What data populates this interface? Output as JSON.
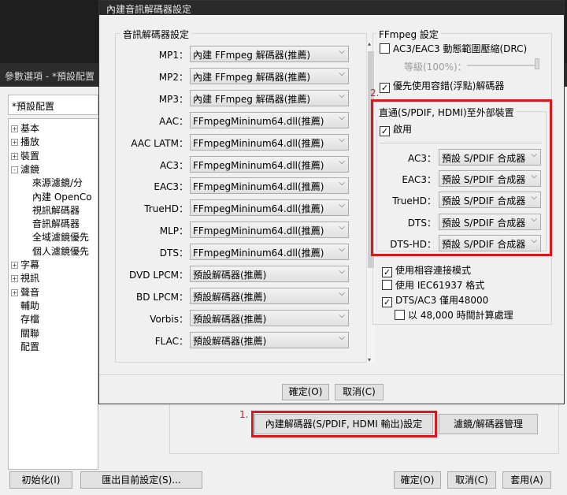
{
  "bg_window": {
    "title": "參數選項 - *預設配置",
    "preset": "*預設配置",
    "tree": [
      {
        "label": "基本",
        "exp": "+"
      },
      {
        "label": "播放",
        "exp": "+"
      },
      {
        "label": "裝置",
        "exp": "+"
      },
      {
        "label": "濾鏡",
        "exp": "-"
      },
      {
        "label": "來源濾鏡/分",
        "exp": ""
      },
      {
        "label": "內建 OpenCo",
        "exp": ""
      },
      {
        "label": "視訊解碼器",
        "exp": ""
      },
      {
        "label": "音訊解碼器",
        "exp": ""
      },
      {
        "label": "全域濾鏡優先",
        "exp": ""
      },
      {
        "label": "個人濾鏡優先",
        "exp": ""
      },
      {
        "label": "字幕",
        "exp": "+"
      },
      {
        "label": "視訊",
        "exp": "+"
      },
      {
        "label": "聲音",
        "exp": "+"
      },
      {
        "label": "輔助",
        "exp": ""
      },
      {
        "label": "存檔",
        "exp": ""
      },
      {
        "label": "關聯",
        "exp": ""
      },
      {
        "label": "配置",
        "exp": ""
      }
    ],
    "builtin_decoder_button": "內建解碼器(S/PDIF, HDMI 輸出)設定",
    "filter_manager_button": "濾鏡/解碼器管理",
    "init_button": "初始化(I)",
    "export_button": "匯出目前設定(S)...",
    "ok_button": "確定(O)",
    "cancel_button": "取消(C)",
    "apply_button": "套用(A)"
  },
  "dialog": {
    "title": "內建音訊解碼器設定",
    "decoder_group": "音訊解碼器設定",
    "decoders": [
      {
        "label": "MP1：",
        "value": "內建 FFmpeg 解碼器(推薦)"
      },
      {
        "label": "MP2：",
        "value": "內建 FFmpeg 解碼器(推薦)"
      },
      {
        "label": "MP3：",
        "value": "內建 FFmpeg 解碼器(推薦)"
      },
      {
        "label": "AAC：",
        "value": "FFmpegMininum64.dll(推薦)"
      },
      {
        "label": "AAC LATM：",
        "value": "FFmpegMininum64.dll(推薦)"
      },
      {
        "label": "AC3：",
        "value": "FFmpegMininum64.dll(推薦)"
      },
      {
        "label": "EAC3：",
        "value": "FFmpegMininum64.dll(推薦)"
      },
      {
        "label": "TrueHD：",
        "value": "FFmpegMininum64.dll(推薦)"
      },
      {
        "label": "MLP：",
        "value": "FFmpegMininum64.dll(推薦)"
      },
      {
        "label": "DTS：",
        "value": "FFmpegMininum64.dll(推薦)"
      },
      {
        "label": "DVD LPCM：",
        "value": "預設解碼器(推薦)"
      },
      {
        "label": "BD LPCM：",
        "value": "預設解碼器(推薦)"
      },
      {
        "label": "Vorbis：",
        "value": "預設解碼器(推薦)"
      },
      {
        "label": "FLAC：",
        "value": "預設解碼器(推薦)"
      }
    ],
    "ffmpeg_group": "FFmpeg 設定",
    "drc_label": "AC3/EAC3 動態範圍壓縮(DRC)",
    "level_label": "等級(100%)：",
    "float_decoder_label": "優先使用容錯(浮點)解碼器",
    "passthrough_group": "直通(S/PDIF, HDMI)至外部裝置",
    "enable_label": "啟用",
    "passthrough": [
      {
        "label": "AC3：",
        "value": "預設 S/PDIF 合成器"
      },
      {
        "label": "EAC3：",
        "value": "預設 S/PDIF 合成器"
      },
      {
        "label": "TrueHD：",
        "value": "預設 S/PDIF 合成器"
      },
      {
        "label": "DTS：",
        "value": "預設 S/PDIF 合成器"
      },
      {
        "label": "DTS-HD：",
        "value": "預設 S/PDIF 合成器"
      }
    ],
    "compat_label": "使用相容連接模式",
    "iec_label": "使用 IEC61937 格式",
    "dts48_label": "DTS/AC3 僅用48000",
    "calc48_label": "以 48,000 時間計算處理",
    "ok_button": "確定(O)",
    "cancel_button": "取消(C)"
  },
  "annotations": {
    "n1": "1.",
    "n2": "2."
  },
  "glyphs": {
    "check": "✓",
    "arrow": "⌵",
    "scroll_up": "▴",
    "scroll_down": "▾"
  }
}
